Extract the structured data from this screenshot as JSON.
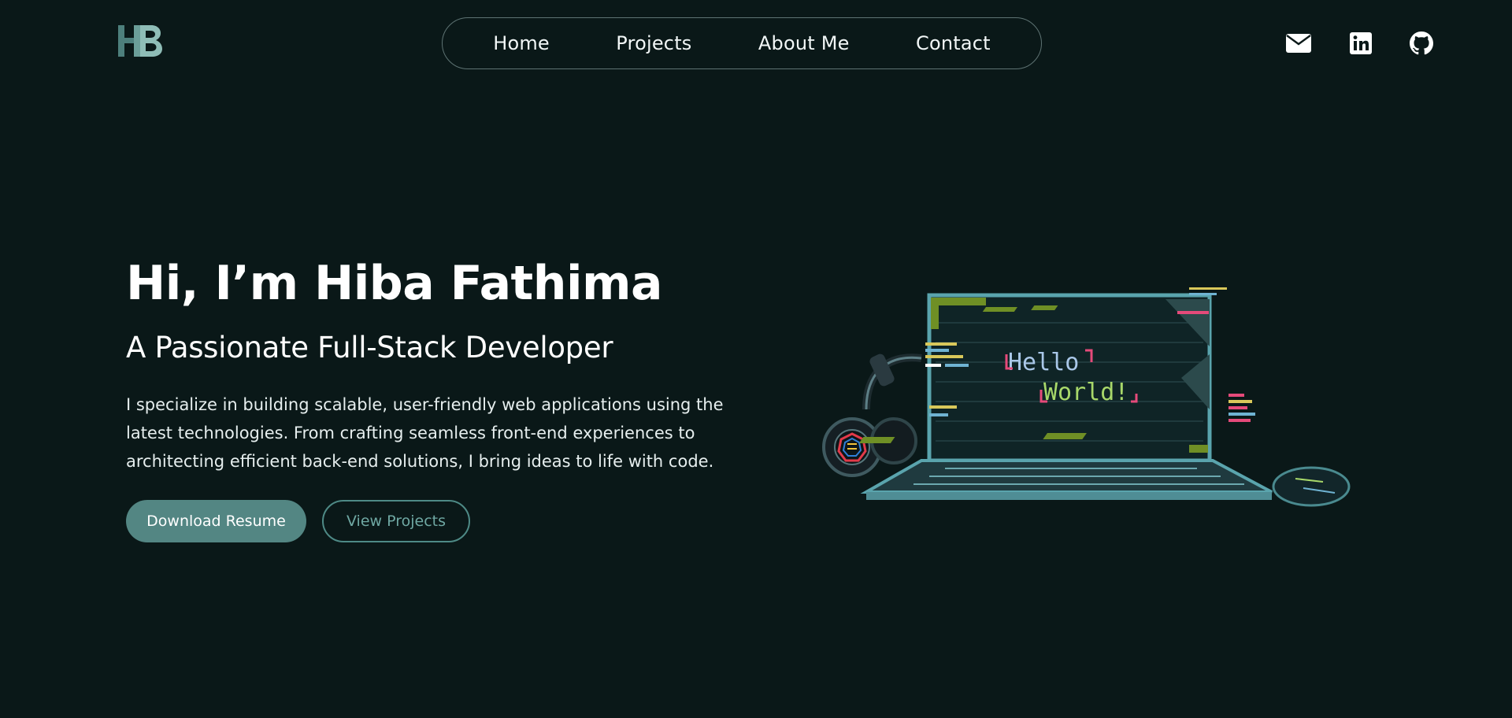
{
  "logo": {
    "text": "HB",
    "icon": "hb-logo-icon"
  },
  "nav": {
    "items": [
      {
        "label": "Home"
      },
      {
        "label": "Projects"
      },
      {
        "label": "About Me"
      },
      {
        "label": "Contact"
      }
    ]
  },
  "social": {
    "email_icon": "envelope-icon",
    "linkedin_icon": "linkedin-icon",
    "github_icon": "github-icon"
  },
  "hero": {
    "title": "Hi, I’m Hiba Fathima",
    "subtitle": "A Passionate Full-Stack Developer",
    "description": "I specialize in building scalable, user-friendly web applications using the latest technologies. From crafting seamless front-end experiences to architecting efficient back-end solutions, I bring ideas to life with code.",
    "primary_button": "Download Resume",
    "secondary_button": "View Projects"
  },
  "illustration": {
    "screen_line1": "Hello",
    "screen_line2": "World!"
  },
  "colors": {
    "background": "#0a1818",
    "accent": "#538683",
    "accent_text": "#6fa8a3",
    "nav_border": "#5e7373"
  }
}
